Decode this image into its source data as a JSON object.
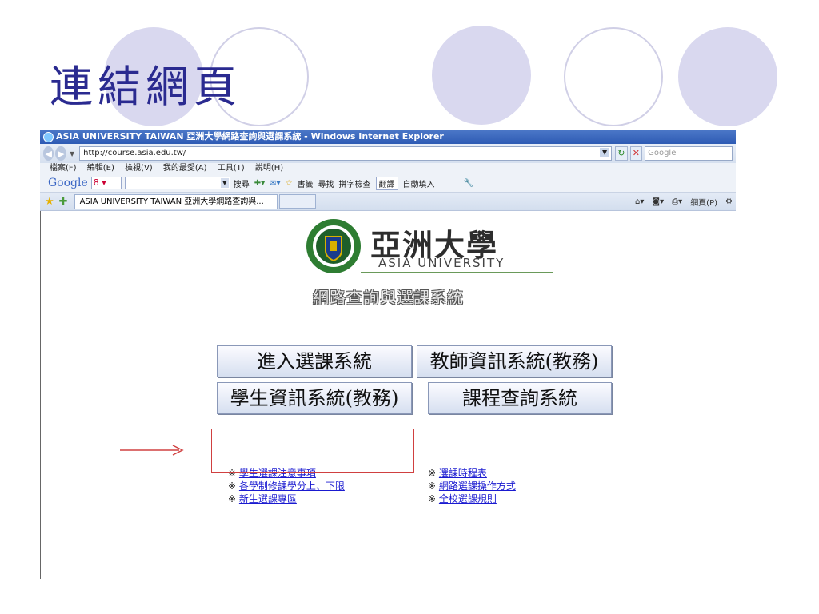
{
  "slide": {
    "title": "連結網頁"
  },
  "browser": {
    "window_title": "ASIA UNIVERSITY TAIWAN 亞洲大學網路查詢與選課系統 - Windows Internet Explorer",
    "url": "http://course.asia.edu.tw/",
    "search_placeholder": "Google",
    "menu": [
      "檔案(F)",
      "編輯(E)",
      "檢視(V)",
      "我的最愛(A)",
      "工具(T)",
      "說明(H)"
    ],
    "google_toolbar": {
      "logo": "Google",
      "box_value": "8 ▾",
      "search": "搜尋",
      "bookmarks": "書籤",
      "find": "尋找",
      "spellcheck": "拼字檢查",
      "translate": "翻譯",
      "autofill": "自動填入"
    },
    "tab_title": "ASIA UNIVERSITY TAIWAN 亞洲大學網路查詢與...",
    "page_menu": "網頁(P)"
  },
  "page": {
    "logo_zh": "亞洲大學",
    "logo_en": "ASIA UNIVERSITY",
    "system_title": "網路查詢與選課系統",
    "buttons": {
      "enter_course_system": "進入選課系統",
      "teacher_info_system": "教師資訊系統(教務)",
      "student_info_system": "學生資訊系統(教務)",
      "course_query_system": "課程查詢系統"
    },
    "links_left": [
      "學生選課注意事項",
      "各學制修課學分上、下限",
      "新生選課專區"
    ],
    "links_right": [
      "選課時程表",
      "網路選課操作方式",
      "全校選課規則"
    ],
    "bullet": "※"
  },
  "colors": {
    "accent_title": "#2a2a90",
    "highlight_box": "#d04040",
    "link": "#1a1ad0"
  }
}
